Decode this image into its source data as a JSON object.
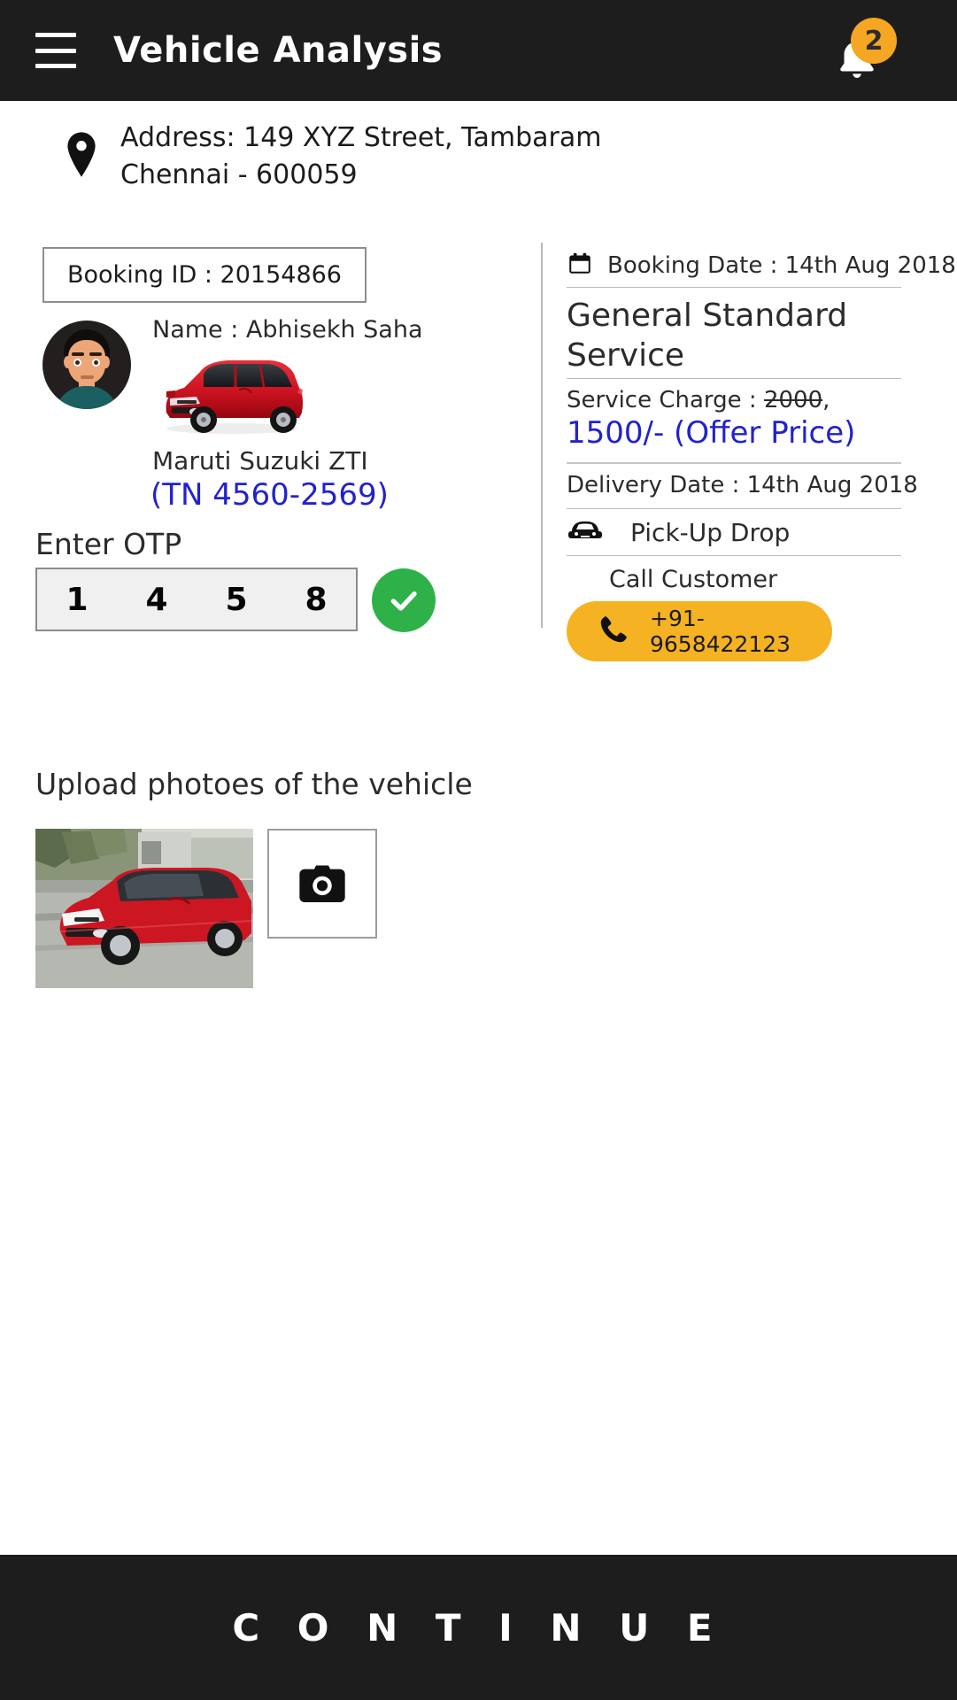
{
  "header": {
    "title": "Vehicle Analysis",
    "menu_icon": "hamburger-menu-icon",
    "notification_icon": "bell-icon",
    "notification_count": "2",
    "bg_color": "#1e1d1d",
    "badge_color": "#f5a623"
  },
  "address": {
    "icon": "location-pin-icon",
    "text": "Address: 149 XYZ Street, Tambaram\nChennai - 600059"
  },
  "booking": {
    "id_label": "Booking ID : 20154866",
    "date_label": "Booking Date : 14th Aug 2018",
    "calendar_icon": "calendar-icon"
  },
  "customer": {
    "name_label": "Name : Abhisekh Saha",
    "avatar_icon": "user-avatar-icon"
  },
  "vehicle": {
    "image_icon": "red-hatchback-car-image",
    "model": "Maruti Suzuki ZTI",
    "plate": "(TN 4560-2569)",
    "plate_color": "#2222cc"
  },
  "otp": {
    "label": "Enter OTP",
    "digits": [
      "1",
      "4",
      "5",
      "8"
    ],
    "confirm_icon": "check-circle-icon",
    "confirm_color": "#2fb14a"
  },
  "service": {
    "title": "General Standard Service",
    "charge_prefix": "Service Charge : ",
    "charge_original": "2000",
    "charge_suffix": ",",
    "offer_price": "1500/- (Offer Price)",
    "offer_color": "#2222cc",
    "delivery_label": "Delivery Date : 14th Aug 2018",
    "pickup_label": "Pick-Up Drop",
    "pickup_icon": "car-front-icon"
  },
  "call": {
    "label": "Call Customer",
    "phone_icon": "phone-icon",
    "number": "+91-9658422123",
    "button_color": "#f5b223"
  },
  "upload": {
    "title": "Upload photoes of the vehicle",
    "thumbnail_icon": "uploaded-car-photo",
    "camera_icon": "camera-icon"
  },
  "footer": {
    "continue_label": "C O N T I N U E",
    "bg_color": "#1e1d1d"
  }
}
